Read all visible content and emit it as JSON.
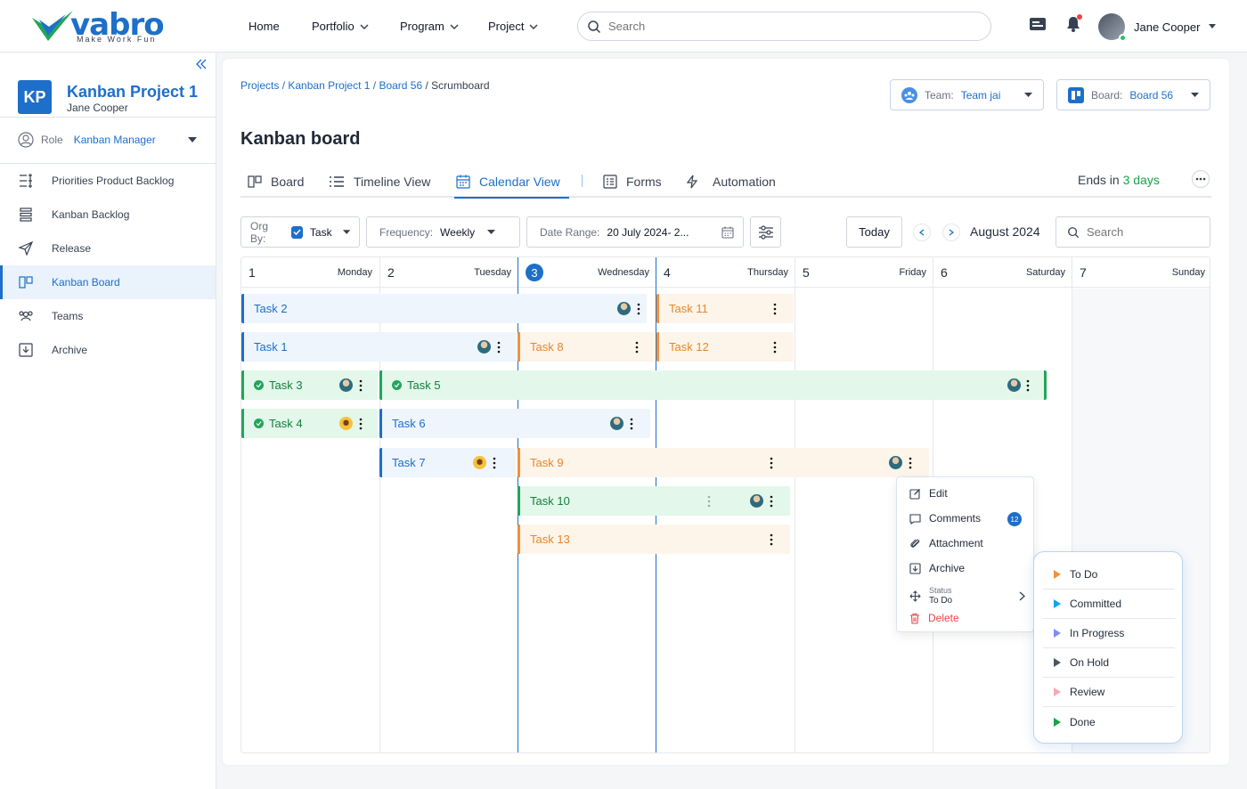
{
  "brand": {
    "name": "vabro",
    "tagline": "Make Work Fun"
  },
  "topnav": {
    "items": [
      {
        "label": "Home"
      },
      {
        "label": "Portfolio"
      },
      {
        "label": "Program"
      },
      {
        "label": "Project"
      }
    ],
    "search_placeholder": "Search",
    "user_name": "Jane Cooper"
  },
  "sidebar": {
    "badge": "KP",
    "project_title": "Kanban Project 1",
    "project_owner": "Jane Cooper",
    "role_label": "Role",
    "role_value": "Kanban Manager",
    "items": [
      {
        "label": "Priorities Product Backlog",
        "icon": "priority-list-icon"
      },
      {
        "label": "Kanban Backlog",
        "icon": "stack-icon"
      },
      {
        "label": "Release",
        "icon": "send-icon"
      },
      {
        "label": "Kanban Board",
        "icon": "board-icon"
      },
      {
        "label": "Teams",
        "icon": "team-icon"
      },
      {
        "label": "Archive",
        "icon": "archive-icon"
      }
    ],
    "active_item": "Kanban Board"
  },
  "breadcrumb": {
    "p1": "Projects",
    "p2": "Kanban Project 1",
    "p3": "Board 56",
    "current": "Scrumboard",
    "sep": " / "
  },
  "selectors": {
    "team_label": "Team:",
    "team_value": "Team jai",
    "board_label": "Board:",
    "board_value": "Board 56"
  },
  "page_title": "Kanban board",
  "tabs": [
    {
      "label": "Board"
    },
    {
      "label": "Timeline View"
    },
    {
      "label": "Calendar View"
    },
    {
      "label": "Forms"
    },
    {
      "label": "Automation"
    }
  ],
  "active_tab": "Calendar View",
  "ends": {
    "prefix": "Ends in",
    "days": "3 days"
  },
  "toolbar": {
    "org_label": "Org By:",
    "org_value": "Task",
    "freq_label": "Frequency:",
    "freq_value": "Weekly",
    "range_label": "Date Range:",
    "range_value": "20 July 2024- 2...",
    "today_label": "Today",
    "month": "August 2024",
    "search_placeholder": "Search"
  },
  "calendar": {
    "days": [
      {
        "num": "1",
        "name": "Monday"
      },
      {
        "num": "2",
        "name": "Tuesday"
      },
      {
        "num": "3",
        "name": "Wednesday",
        "today": true
      },
      {
        "num": "4",
        "name": "Thursday"
      },
      {
        "num": "5",
        "name": "Friday"
      },
      {
        "num": "6",
        "name": "Saturday"
      },
      {
        "num": "7",
        "name": "Sunday"
      }
    ],
    "tasks": [
      {
        "name": "Task  2",
        "color": "blue"
      },
      {
        "name": "Task 11",
        "color": "orange"
      },
      {
        "name": "Task 1",
        "color": "blue"
      },
      {
        "name": "Task 8",
        "color": "orange"
      },
      {
        "name": "Task 12",
        "color": "orange"
      },
      {
        "name": "Task 3",
        "color": "green"
      },
      {
        "name": "Task 5",
        "color": "green"
      },
      {
        "name": "Task 4",
        "color": "green"
      },
      {
        "name": "Task 6",
        "color": "blue"
      },
      {
        "name": "Task 7",
        "color": "blue"
      },
      {
        "name": "Task 9",
        "color": "orange"
      },
      {
        "name": "Task 10",
        "color": "green"
      },
      {
        "name": "Task 13",
        "color": "orange"
      }
    ]
  },
  "context_menu": {
    "edit": "Edit",
    "comments": "Comments",
    "comments_count": "12",
    "attachment": "Attachment",
    "archive": "Archive",
    "status_label": "Status",
    "status_value": "To Do",
    "delete": "Delete"
  },
  "status_submenu": [
    {
      "label": "To Do",
      "color": "#f0923a"
    },
    {
      "label": "Committed",
      "color": "#0ea5e9"
    },
    {
      "label": "In Progress",
      "color": "#818cf8"
    },
    {
      "label": "On Hold",
      "color": "#4b5563"
    },
    {
      "label": "Review",
      "color": "#f9a8b4"
    },
    {
      "label": "Done",
      "color": "#16a34a"
    }
  ],
  "colors": {
    "brand_blue": "#1d6fc9",
    "green": "#22a55a",
    "orange": "#f0923a"
  }
}
